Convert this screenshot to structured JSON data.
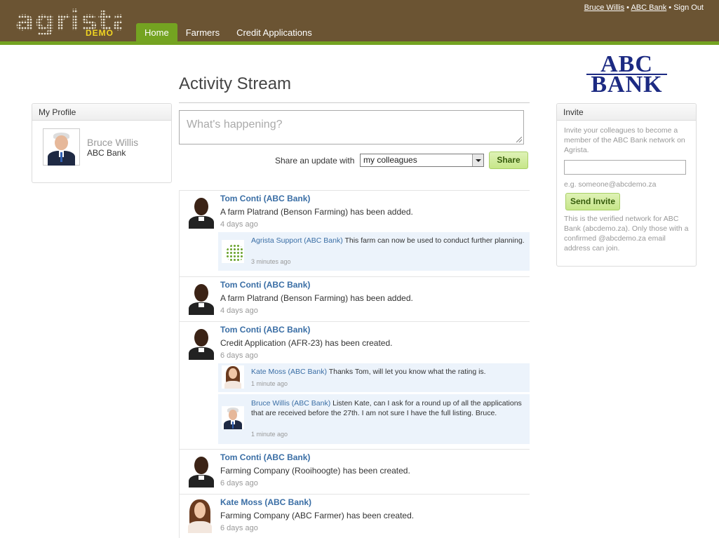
{
  "header": {
    "logo_text": "agrista",
    "logo_badge": "DEMO",
    "nav": [
      "Home",
      "Farmers",
      "Credit Applications"
    ],
    "user_link": "Bruce Willis",
    "bank_link": "ABC Bank",
    "sign_out": "Sign Out",
    "separator": "•"
  },
  "bank_logo": {
    "line1": "ABC",
    "line2": "BANK"
  },
  "page": {
    "title": "Activity Stream"
  },
  "profile": {
    "heading": "My Profile",
    "name": "Bruce Willis",
    "org": "ABC Bank"
  },
  "composer": {
    "placeholder": "What's happening?",
    "share_label": "Share an update with",
    "share_with": "my colleagues",
    "share_button": "Share"
  },
  "invite": {
    "heading": "Invite",
    "intro": "Invite your colleagues to become a member of the ABC Bank network on Agrista.",
    "hint": "e.g. someone@abcdemo.za",
    "button": "Send Invite",
    "footer": "This is the verified network for ABC Bank (abcdemo.za). Only those with a confirmed @abcdemo.za email address can join."
  },
  "posts": [
    {
      "author": "Tom Conti (ABC Bank)",
      "message": "A farm Platrand (Benson Farming) has been added.",
      "time": "4 days ago",
      "comments": [
        {
          "author": "Agrista Support (ABC Bank)",
          "text": "This farm can now be used to conduct further planning.",
          "time": "3 minutes ago"
        }
      ]
    },
    {
      "author": "Tom Conti (ABC Bank)",
      "message": "A farm Platrand (Benson Farming) has been added.",
      "time": "4 days ago",
      "comments": []
    },
    {
      "author": "Tom Conti (ABC Bank)",
      "message": "Credit Application (AFR-23) has been created.",
      "time": "6 days ago",
      "comments": [
        {
          "author": "Kate Moss (ABC Bank)",
          "text": "Thanks Tom, will let you know what the rating is.",
          "time": "1 minute ago"
        },
        {
          "author": "Bruce Willis (ABC Bank)",
          "text": "Listen Kate, can I ask for a round up of all the applications that are received before the 27th. I am not sure I have the full listing. Bruce.",
          "time": "1 minute ago"
        }
      ]
    },
    {
      "author": "Tom Conti (ABC Bank)",
      "message": "Farming Company (Rooihoogte) has been created.",
      "time": "6 days ago",
      "comments": []
    },
    {
      "author": "Kate Moss (ABC Bank)",
      "message": "Farming Company (ABC Farmer) has been created.",
      "time": "6 days ago",
      "comments": []
    }
  ]
}
